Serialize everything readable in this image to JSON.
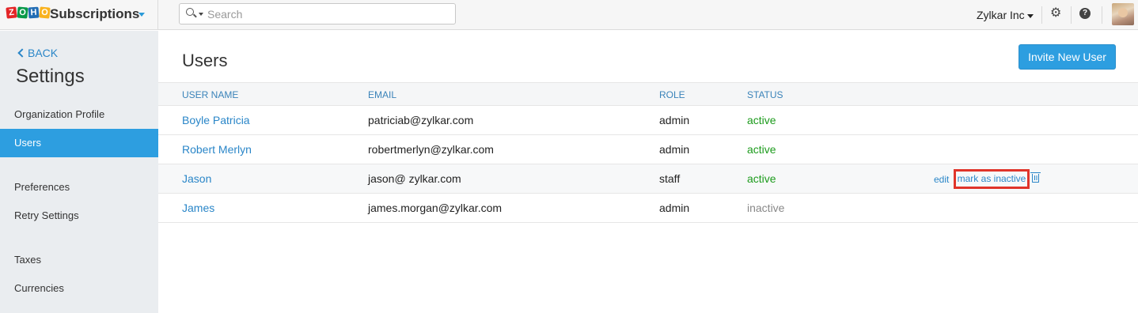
{
  "app": {
    "logo_letters": [
      "Z",
      "O",
      "H",
      "O"
    ],
    "logo_text": "ZOHO",
    "title": "Subscriptions"
  },
  "search": {
    "placeholder": "Search",
    "value": ""
  },
  "header": {
    "org_name": "Zylkar Inc",
    "help_glyph": "?"
  },
  "sidebar": {
    "back_label": "BACK",
    "title": "Settings",
    "items": [
      {
        "label": "Organization Profile",
        "active": false
      },
      {
        "label": "Users",
        "active": true
      },
      {
        "label": "Preferences",
        "active": false
      },
      {
        "label": "Retry Settings",
        "active": false
      },
      {
        "label": "Taxes",
        "active": false
      },
      {
        "label": "Currencies",
        "active": false
      }
    ]
  },
  "main": {
    "title": "Users",
    "invite_button": "Invite New User",
    "columns": [
      "USER NAME",
      "EMAIL",
      "ROLE",
      "STATUS"
    ],
    "rows": [
      {
        "name": "Boyle Patricia",
        "email": "patriciab@zylkar.com",
        "role": "admin",
        "status": "active"
      },
      {
        "name": "Robert Merlyn",
        "email": "robertmerlyn@zylkar.com",
        "role": "admin",
        "status": "active"
      },
      {
        "name": "Jason",
        "email": "jason@ zylkar.com",
        "role": "staff",
        "status": "active"
      },
      {
        "name": "James",
        "email": "james.morgan@zylkar.com",
        "role": "admin",
        "status": "inactive"
      }
    ],
    "row_actions": {
      "edit": "edit",
      "mark_inactive": "mark as inactive"
    }
  },
  "colors": {
    "accent": "#2d9ee0",
    "link": "#2a86c8",
    "status_active": "#1c9b1c",
    "status_inactive": "#888888",
    "highlight": "#e0342a"
  },
  "icons": [
    "search-icon",
    "chevron-down-icon",
    "gear-icon",
    "help-icon",
    "avatar",
    "back-chevron-icon",
    "trash-icon"
  ]
}
